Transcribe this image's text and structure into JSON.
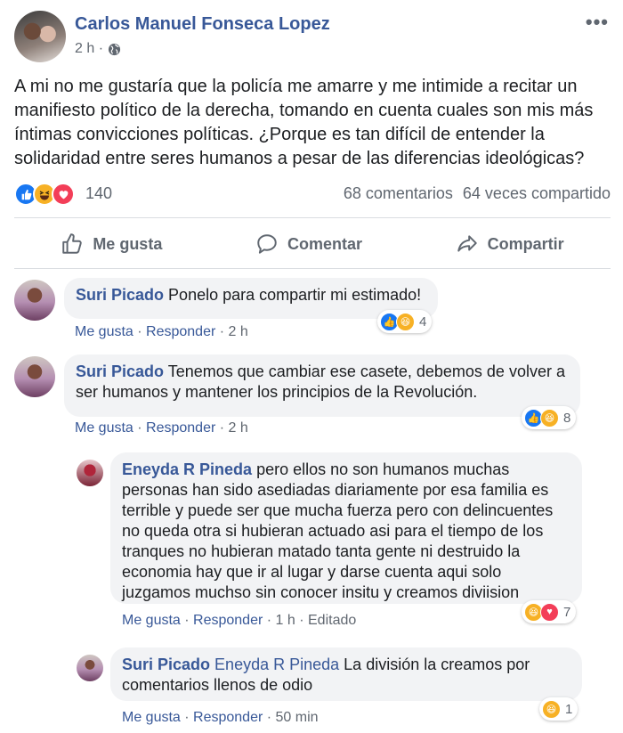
{
  "post": {
    "author": "Carlos Manuel Fonseca Lopez",
    "time": "2 h ·",
    "text": "A mi no me gustaría que la policía me amarre y me intimide a recitar un manifiesto político de la derecha, tomando en cuenta cuales son mis más íntimas convicciones políticas. ¿Porque es tan difícil de entender la solidaridad entre seres humanos a pesar de las diferencias ideológicas?",
    "reaction_count": "140",
    "comments_count": "68 comentarios",
    "shares_count": "64 veces compartido"
  },
  "actions": {
    "like": "Me gusta",
    "comment": "Comentar",
    "share": "Compartir"
  },
  "comments": [
    {
      "author": "Suri Picado",
      "text": "Ponelo para compartir mi estimado!",
      "like": "Me gusta",
      "reply": "Responder",
      "time": "2 h",
      "reactions": "4"
    },
    {
      "author": "Suri Picado",
      "text": "Tenemos que cambiar ese casete, debemos de volver a ser humanos y mantener los principios de la Revolución.",
      "like": "Me gusta",
      "reply": "Responder",
      "time": "2 h",
      "reactions": "8"
    },
    {
      "author": "Eneyda R Pineda",
      "text": "pero ellos no son humanos muchas personas han sido asediadas diariamente por esa familia es terrible y puede ser que mucha fuerza pero con delincuentes no queda otra si hubieran actuado asi para el tiempo de los tranques no hubieran matado tanta gente ni destruido la economia hay que ir al lugar y darse cuenta aqui solo juzgamos muchso sin conocer insitu y creamos diviision",
      "like": "Me gusta",
      "reply": "Responder",
      "time": "1 h",
      "edited": "Editado",
      "reactions": "7"
    },
    {
      "author": "Suri Picado",
      "tag": "Eneyda R Pineda",
      "text": "La división la creamos por comentarios llenos de odio",
      "like": "Me gusta",
      "reply": "Responder",
      "time": "50 min",
      "reactions": "1"
    }
  ],
  "colors": {
    "link": "#385898",
    "muted": "#606770",
    "bubble": "#f2f3f5",
    "like": "#1877f2",
    "haha": "#f7b125",
    "love": "#f33e58"
  }
}
